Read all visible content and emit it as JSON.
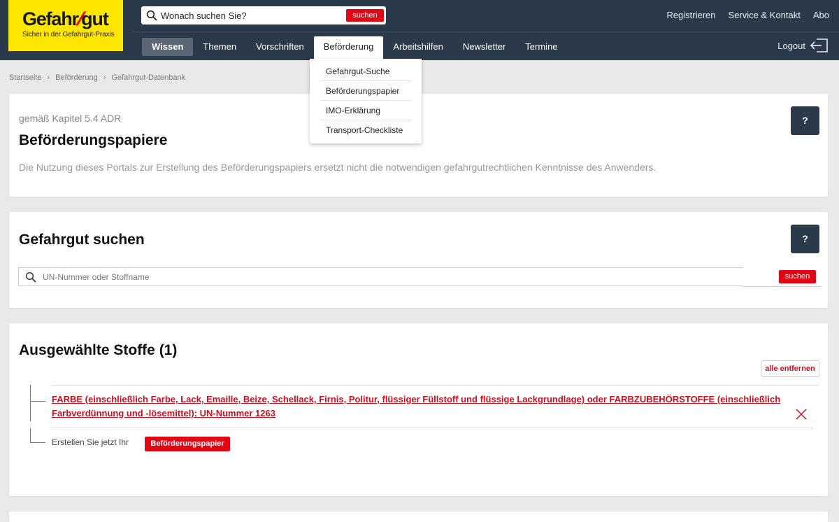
{
  "logo": {
    "main_left": "Gefahr",
    "main_slash": "/",
    "main_right": "gut",
    "tagline": "Sicher in der Gefahrgut-Praxis"
  },
  "top_search": {
    "placeholder": "Wonach suchen Sie?",
    "button": "suchen"
  },
  "top_links": [
    "Registrieren",
    "Service & Kontakt",
    "Abo"
  ],
  "nav": {
    "items": [
      "Wissen",
      "Themen",
      "Vorschriften",
      "Beförderung",
      "Arbeitshilfen",
      "Newsletter",
      "Termine"
    ],
    "active": "Wissen",
    "open": "Beförderung",
    "logout": "Logout"
  },
  "dropdown": {
    "items": [
      "Gefahrgut-Suche",
      "Beförderungspapier",
      "IMO-Erklärung",
      "Transport-Checkliste"
    ]
  },
  "breadcrumb": {
    "items": [
      "Startseite",
      "Beförderung",
      "Gefahrgut-Datenbank"
    ],
    "separator": "›"
  },
  "card_intro": {
    "subtitle": "gemäß Kapitel 5.4 ADR",
    "title": "Beförderungspapiere",
    "description": "Die Nutzung dieses Portals zur Erstellung des Beförderungspapiers ersetzt nicht die notwendigen gefahrgutrechtlichen Kenntnisse des Anwenders.",
    "help": "?"
  },
  "card_search": {
    "title": "Gefahrgut suchen",
    "placeholder": "UN-Nummer oder Stoffname",
    "button": "suchen",
    "help": "?"
  },
  "card_selected": {
    "title": "Ausgewählte Stoffe (1)",
    "remove_all": "alle entfernen",
    "item_label": "FARBE (einschließlich Farbe, Lack, Emaille, Beize, Schellack, Firnis, Politur, flüssiger Füllstoff und flüssige Lackgrundlage) oder FARBZUBEHÖRSTOFFE (einschließlich Farbverdünnung und -lösemittel): UN-Nummer 1263",
    "create_label": "Erstellen Sie jetzt Ihr",
    "create_button": "Beförderungspapier"
  },
  "colors": {
    "header_bg": "#2b3a4a",
    "logo_bg": "#ffe600",
    "accent_red": "#e10613",
    "link_red": "#c8101e"
  }
}
